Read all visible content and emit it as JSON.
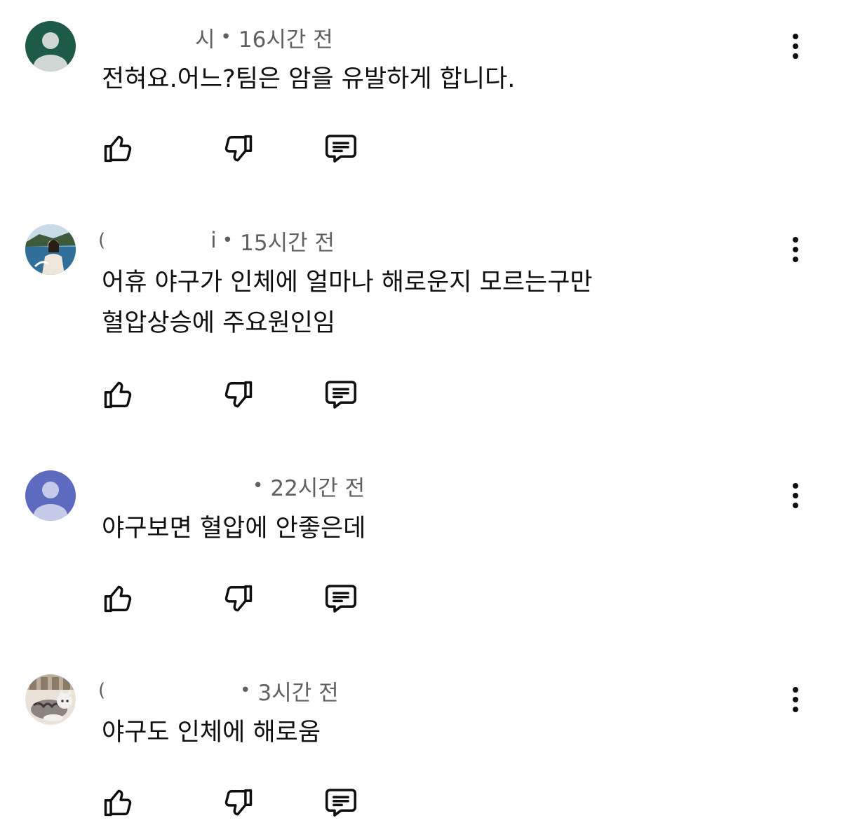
{
  "comments": [
    {
      "author_fragment": "시",
      "time": "16시간 전",
      "text_lines": [
        "전혀요.어느?팀은 암을 유발하게 합니다."
      ],
      "avatar": "default-avatar-icon",
      "avatar_color": "#1e5a48"
    },
    {
      "author_fragment_start": "(",
      "author_fragment": "i",
      "time": "15시간 전",
      "text_lines": [
        "어휴 야구가 인체에 얼마나 해로운지 모르는구만",
        "혈압상승에 주요원인임"
      ],
      "avatar": "photo-avatar-beach"
    },
    {
      "author_fragment": "",
      "time": "22시간 전",
      "text_lines": [
        "야구보면 혈압에 안좋은데"
      ],
      "avatar": "default-avatar-icon",
      "avatar_color": "#5c6bc0"
    },
    {
      "author_fragment_start": "(",
      "author_fragment": "",
      "time": "3시간 전",
      "text_lines": [
        "야구도 인체에 해로움"
      ],
      "avatar": "photo-avatar-cat"
    }
  ],
  "icons": {
    "like": "thumbs-up-icon",
    "dislike": "thumbs-down-icon",
    "reply": "reply-comment-icon",
    "more": "more-vertical-icon"
  },
  "dot_separator": "•"
}
